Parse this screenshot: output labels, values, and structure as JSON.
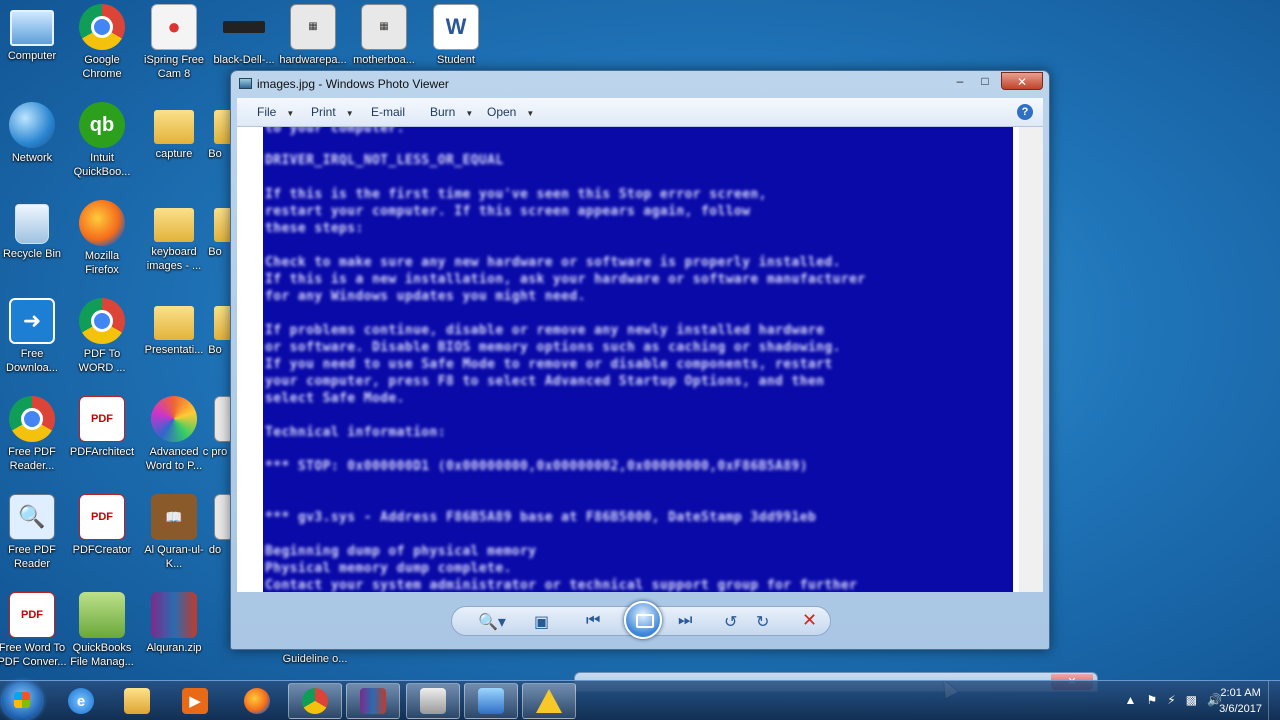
{
  "desktop": {
    "icons": [
      {
        "label": "Computer",
        "icon": "computer-icon"
      },
      {
        "label": "Google Chrome",
        "icon": "chrome-icon"
      },
      {
        "label": "iSpring Free Cam 8",
        "icon": "ispring-icon"
      },
      {
        "label": "black-Dell-...",
        "icon": "image-file-icon"
      },
      {
        "label": "hardwarepa...",
        "icon": "image-file-icon"
      },
      {
        "label": "motherboa...",
        "icon": "image-file-icon"
      },
      {
        "label": "Student",
        "icon": "word-document-icon"
      },
      {
        "label": "Network",
        "icon": "network-icon"
      },
      {
        "label": "Intuit QuickBoo...",
        "icon": "quickbooks-icon"
      },
      {
        "label": "capture",
        "icon": "folder-icon"
      },
      {
        "label": "Bo",
        "icon": "folder-icon"
      },
      {
        "label": "Recycle Bin",
        "icon": "recycle-bin-icon"
      },
      {
        "label": "Mozilla Firefox",
        "icon": "firefox-icon"
      },
      {
        "label": "keyboard images - ...",
        "icon": "folder-icon"
      },
      {
        "label": "Bo",
        "icon": "folder-icon"
      },
      {
        "label": "Free Downloa...",
        "icon": "download-icon"
      },
      {
        "label": "PDF To WORD ...",
        "icon": "chrome-icon"
      },
      {
        "label": "Presentati...",
        "icon": "folder-icon"
      },
      {
        "label": "Bo",
        "icon": "folder-icon"
      },
      {
        "label": "Free PDF Reader...",
        "icon": "chrome-icon"
      },
      {
        "label": "PDFArchitect",
        "icon": "pdf-icon"
      },
      {
        "label": "Advanced Word to P...",
        "icon": "app-icon"
      },
      {
        "label": "c pro",
        "icon": "app-icon"
      },
      {
        "label": "Free PDF Reader",
        "icon": "pdf-reader-icon"
      },
      {
        "label": "PDFCreator",
        "icon": "pdf-icon"
      },
      {
        "label": "Al Quran-ul-K...",
        "icon": "book-icon"
      },
      {
        "label": "do",
        "icon": "app-icon"
      },
      {
        "label": "Free Word To PDF Conver...",
        "icon": "pdf-icon"
      },
      {
        "label": "QuickBooks File Manag...",
        "icon": "zip-icon"
      },
      {
        "label": "Alquran.zip",
        "icon": "winrar-icon"
      },
      {
        "label": "Guideline o...",
        "icon": "document-icon"
      }
    ]
  },
  "window": {
    "title": "images.jpg - Windows Photo Viewer",
    "min_label": "–",
    "max_label": "□",
    "close_label": "✕",
    "menu": [
      {
        "label": "File",
        "has_arrow": true
      },
      {
        "label": "Print",
        "has_arrow": true
      },
      {
        "label": "E-mail",
        "has_arrow": false
      },
      {
        "label": "Burn",
        "has_arrow": true
      },
      {
        "label": "Open",
        "has_arrow": true
      }
    ],
    "help_label": "?",
    "image_text_lines": [
      "to your computer.",
      "DRIVER_IRQL_NOT_LESS_OR_EQUAL",
      "If this is the first time you've seen this Stop error screen,",
      "restart your computer. If this screen appears again, follow",
      "these steps:",
      "Check to make sure any new hardware or software is properly installed.",
      "If this is a new installation, ask your hardware or software manufacturer",
      "for any Windows updates you might need.",
      "If problems continue, disable or remove any newly installed hardware",
      "or software. Disable BIOS memory options such as caching or shadowing.",
      "If you need to use Safe Mode to remove or disable components, restart",
      "your computer, press F8 to select Advanced Startup Options, and then",
      "select Safe Mode.",
      "Technical information:",
      "*** STOP: 0x000000D1 (0x00000000,0x00000002,0x00000000,0xF86B5A89)",
      "***      gv3.sys - Address F86B5A89 base at F86B5000, DateStamp 3dd991eb",
      "Beginning dump of physical memory",
      "Physical memory dump complete.",
      "Contact your system administrator or technical support group for further"
    ],
    "controls": {
      "zoom": "zoom-icon",
      "actual_size": "fit-window-icon",
      "previous": "previous-icon",
      "slideshow": "slideshow-icon",
      "next": "next-icon",
      "rotate_ccw": "rotate-counterclockwise-icon",
      "rotate_cw": "rotate-clockwise-icon",
      "delete": "delete-icon"
    }
  },
  "taskbar": {
    "buttons": [
      {
        "name": "internet-explorer",
        "glyph": "e"
      },
      {
        "name": "windows-explorer",
        "glyph": ""
      },
      {
        "name": "media-player",
        "glyph": "▶"
      },
      {
        "name": "firefox",
        "glyph": ""
      },
      {
        "name": "chrome",
        "glyph": ""
      },
      {
        "name": "winrar",
        "glyph": ""
      },
      {
        "name": "printer",
        "glyph": ""
      },
      {
        "name": "photo-viewer",
        "glyph": ""
      },
      {
        "name": "warning",
        "glyph": "!"
      }
    ],
    "time": "2:01 AM",
    "date": "3/6/2017"
  },
  "colors": {
    "bsod_blue": "#0a0aa8",
    "desktop_blue": "#1f74b8"
  }
}
